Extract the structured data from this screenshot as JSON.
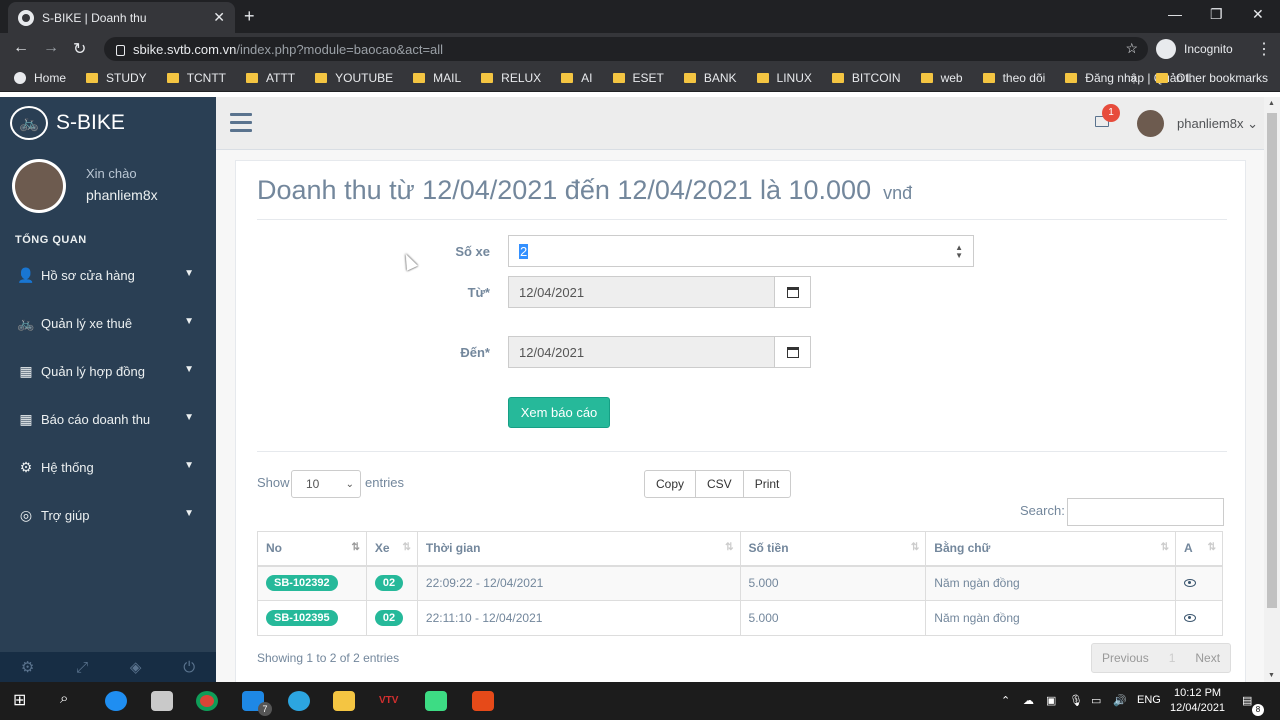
{
  "browser": {
    "tab_title": "S-BIKE | Doanh thu",
    "url_host": "sbike.svtb.com.vn",
    "url_path": "/index.php?module=baocao&act=all",
    "incognito_label": "Incognito",
    "bookmarks": [
      "Home",
      "STUDY",
      "TCNTT",
      "ATTT",
      "YOUTUBE",
      "MAIL",
      "RELUX",
      "AI",
      "ESET",
      "BANK",
      "LINUX",
      "BITCOIN",
      "web",
      "theo dõi",
      "Đăng nhập | Quản l..."
    ],
    "other_bookmarks": "Other bookmarks"
  },
  "sidebar": {
    "brand": "S-BIKE",
    "greeting": "Xin chào",
    "username": "phanliem8x",
    "section_title": "TỔNG QUAN",
    "items": [
      {
        "label": "Hồ sơ cửa hàng",
        "icon": "user-icon"
      },
      {
        "label": "Quản lý xe thuê",
        "icon": "bicycle-icon"
      },
      {
        "label": "Quản lý hợp đồng",
        "icon": "qrcode-icon"
      },
      {
        "label": "Báo cáo doanh thu",
        "icon": "qrcode-icon"
      },
      {
        "label": "Hệ thống",
        "icon": "gear-icon"
      },
      {
        "label": "Trợ giúp",
        "icon": "lifebuoy-icon"
      }
    ]
  },
  "topnav": {
    "notification_count": "1",
    "username": "phanliem8x"
  },
  "main": {
    "title": "Doanh thu từ 12/04/2021 đến 12/04/2021 là 10.000",
    "title_unit": "vnđ",
    "form": {
      "so_xe_label": "Số xe",
      "so_xe_value": "2",
      "tu_label": "Từ*",
      "tu_value": "12/04/2021",
      "den_label": "Đến*",
      "den_value": "12/04/2021",
      "submit_label": "Xem báo cáo"
    },
    "table_controls": {
      "show_label": "Show",
      "page_size": "10",
      "entries_label": "entries",
      "buttons": [
        "Copy",
        "CSV",
        "Print"
      ],
      "search_label": "Search:"
    },
    "table": {
      "headers": [
        "No",
        "Xe",
        "Thời gian",
        "Số tiền",
        "Bằng chữ",
        "A"
      ],
      "rows": [
        {
          "no": "SB-102392",
          "xe": "02",
          "time": "22:09:22 - 12/04/2021",
          "amount": "5.000",
          "words": "Năm ngàn đồng"
        },
        {
          "no": "SB-102395",
          "xe": "02",
          "time": "22:11:10 - 12/04/2021",
          "amount": "5.000",
          "words": "Năm ngàn đồng"
        }
      ]
    },
    "info": "Showing 1 to 2 of 2 entries",
    "pager": {
      "previous": "Previous",
      "page": "1",
      "next": "Next"
    }
  },
  "taskbar": {
    "lang": "ENG",
    "time": "10:12 PM",
    "date": "12/04/2021",
    "mail_badge": "7",
    "notif_badge": "8"
  }
}
